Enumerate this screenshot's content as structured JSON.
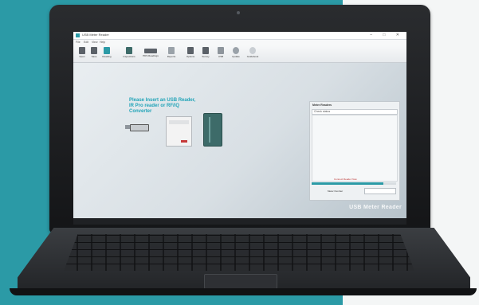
{
  "window": {
    "title": "USB Meter Reader",
    "buttons": "–  □  ✕"
  },
  "menubar": [
    "File",
    "Edit",
    "View",
    "Help"
  ],
  "toolbar": [
    {
      "label": "Open",
      "icon": "folder-icon"
    },
    {
      "label": "Save",
      "icon": "save-icon"
    },
    {
      "label": "Reading",
      "icon": "play-icon"
    },
    {
      "label": "Inspections",
      "icon": "battery-icon"
    },
    {
      "label": "PDS Readings",
      "icon": "device-icon"
    },
    {
      "label": "Reports",
      "icon": "report-icon"
    },
    {
      "label": "Options",
      "icon": "options-icon"
    },
    {
      "label": "Survey",
      "icon": "survey-icon"
    },
    {
      "label": "USB",
      "icon": "usb-icon"
    },
    {
      "label": "Update",
      "icon": "update-icon"
    },
    {
      "label": "Guidebook",
      "icon": "globe-icon"
    }
  ],
  "main": {
    "prompt": "Please Insert an USB Reader, IR Pro reader or RF/IQ Converter"
  },
  "panel": {
    "header": "Meter Readers",
    "row": "Check status",
    "link": "Connect Reader Now",
    "progress": 0.85,
    "bottom_label": "Meter Number",
    "select_value": "—"
  },
  "watermark": "USB Meter Reader",
  "colors": {
    "accent": "#2b9aa6",
    "prompt_text": "#22a4b8"
  }
}
